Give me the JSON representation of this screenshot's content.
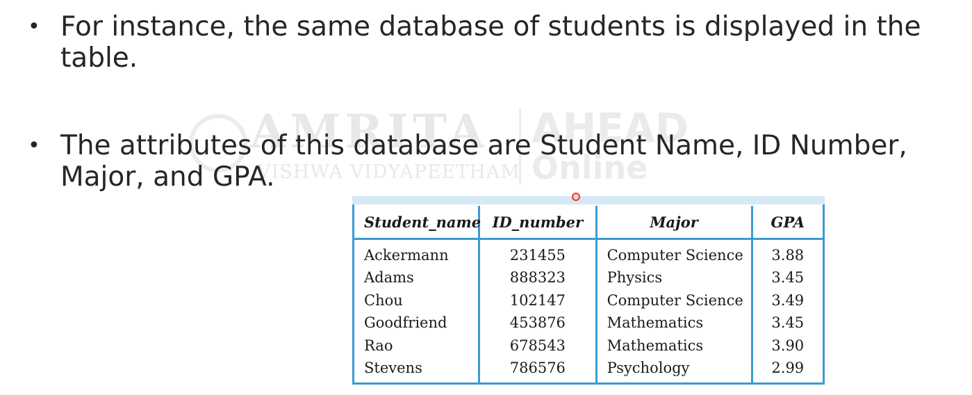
{
  "bullets": [
    {
      "text": "For instance, the same database of students is displayed in the table."
    },
    {
      "text": "The attributes of this database are Student Name, ID Number, Major, and GPA."
    }
  ],
  "bullet_glyph": "•",
  "watermark": {
    "brand": "AMRITA",
    "subtitle": "VISHWA VIDYAPEETHAM",
    "product_top": "AHEAD",
    "product_bottom": "Online"
  },
  "table": {
    "headers": [
      "Student_name",
      "ID_number",
      "Major",
      "GPA"
    ],
    "rows": [
      [
        "Ackermann",
        "231455",
        "Computer Science",
        "3.88"
      ],
      [
        "Adams",
        "888323",
        "Physics",
        "3.45"
      ],
      [
        "Chou",
        "102147",
        "Computer Science",
        "3.49"
      ],
      [
        "Goodfriend",
        "453876",
        "Mathematics",
        "3.45"
      ],
      [
        "Rao",
        "678543",
        "Mathematics",
        "3.90"
      ],
      [
        "Stevens",
        "786576",
        "Psychology",
        "2.99"
      ]
    ]
  },
  "colors": {
    "table_border": "#3a9bd5",
    "text": "#262626",
    "cursor": "#e53935"
  }
}
